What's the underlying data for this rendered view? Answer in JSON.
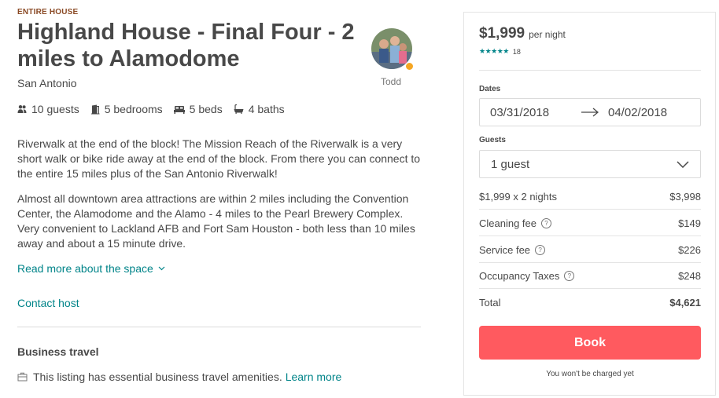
{
  "listing": {
    "kind": "ENTIRE HOUSE",
    "title": "Highland House - Final Four - 2 miles to Alamodome",
    "city": "San Antonio",
    "host_name": "Todd",
    "amenities": {
      "guests": "10 guests",
      "bedrooms": "5 bedrooms",
      "beds": "5 beds",
      "baths": "4 baths"
    },
    "description": [
      "Riverwalk at the end of the block! The Mission Reach of the Riverwalk is a very short walk or bike ride away at the end of the block. From there you can connect to the entire 15 miles plus of the San Antonio Riverwalk!",
      "Almost all downtown area attractions are within 2 miles including the Convention Center, the Alamodome and the Alamo - 4 miles to the Pearl Brewery Complex. Very convenient to Lackland AFB and Fort Sam Houston - both less than 10 miles away and about a 15 minute drive."
    ],
    "read_more_label": "Read more about the space",
    "contact_host_label": "Contact host",
    "business_travel": {
      "title": "Business travel",
      "text": "This listing has essential business travel amenities.",
      "learn_more": "Learn more"
    }
  },
  "booking": {
    "price": "$1,999",
    "price_unit": "per night",
    "stars": "★★★★★",
    "rating_count": "18",
    "dates_label": "Dates",
    "check_in": "03/31/2018",
    "check_out": "04/02/2018",
    "guests_label": "Guests",
    "guests_value": "1 guest",
    "lines": [
      {
        "label": "$1,999 x 2 nights",
        "value": "$3,998"
      },
      {
        "label": "Cleaning fee",
        "value": "$149"
      },
      {
        "label": "Service fee",
        "value": "$226"
      },
      {
        "label": "Occupancy Taxes",
        "value": "$248"
      },
      {
        "label": "Total",
        "value": "$4,621"
      }
    ],
    "help_glyph": "?",
    "book_label": "Book",
    "note": "You won't be charged yet"
  },
  "colors": {
    "accent": "#008489",
    "book_button": "#ff5a5f",
    "superhost_badge": "#f5a623",
    "kicker": "#8a4a25"
  },
  "icons": [
    "guests-icon",
    "bedrooms-icon",
    "beds-icon",
    "baths-icon",
    "chevron-down-icon",
    "arrow-right-icon",
    "briefcase-icon",
    "help-icon"
  ]
}
